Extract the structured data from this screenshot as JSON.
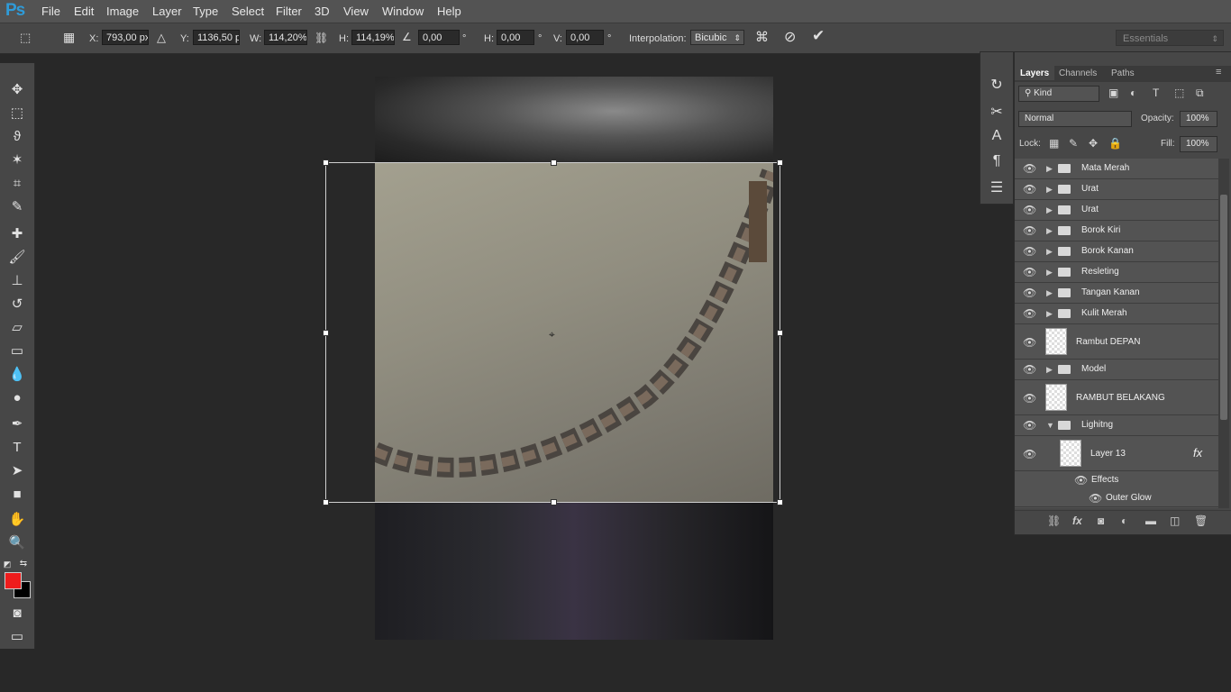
{
  "app": {
    "logo": "Ps"
  },
  "menu": [
    "File",
    "Edit",
    "Image",
    "Layer",
    "Type",
    "Select",
    "Filter",
    "3D",
    "View",
    "Window",
    "Help"
  ],
  "options": {
    "x_label": "X:",
    "x_value": "793,00 px",
    "y_label": "Y:",
    "y_value": "1136,50 p:",
    "w_label": "W:",
    "w_value": "114,20%",
    "h_label": "H:",
    "h_value": "114,19%",
    "angle_value": "0,00",
    "angle_unit": "°",
    "hskew_label": "H:",
    "hskew_value": "0,00",
    "hskew_unit": "°",
    "vskew_label": "V:",
    "vskew_value": "0,00",
    "vskew_unit": "°",
    "interpolation_label": "Interpolation:",
    "interpolation_value": "Bicubic",
    "workspace": "Essentials"
  },
  "colors": {
    "foreground": "#ee1c1c",
    "background": "#000000",
    "accent": "#2f9bd8"
  },
  "layers_panel": {
    "tabs": [
      "Layers",
      "Channels",
      "Paths"
    ],
    "filter": "Kind",
    "blend_mode": "Normal",
    "opacity_label": "Opacity:",
    "opacity_value": "100%",
    "lock_label": "Lock:",
    "fill_label": "Fill:",
    "fill_value": "100%",
    "layers": [
      {
        "name": "Mata Merah",
        "type": "group"
      },
      {
        "name": "Urat",
        "type": "group"
      },
      {
        "name": "Urat",
        "type": "group"
      },
      {
        "name": "Borok Kiri",
        "type": "group"
      },
      {
        "name": "Borok Kanan",
        "type": "group"
      },
      {
        "name": "Resleting",
        "type": "group"
      },
      {
        "name": "Tangan Kanan",
        "type": "group"
      },
      {
        "name": "Kulit Merah",
        "type": "group"
      },
      {
        "name": "Rambut DEPAN",
        "type": "layer"
      },
      {
        "name": "Model",
        "type": "group"
      },
      {
        "name": "RAMBUT BELAKANG",
        "type": "layer"
      },
      {
        "name": "Lighitng",
        "type": "group-open"
      },
      {
        "name": "Layer 13",
        "type": "layer-fx"
      },
      {
        "name": "Effects",
        "type": "effects"
      },
      {
        "name": "Outer Glow",
        "type": "effect"
      }
    ]
  }
}
